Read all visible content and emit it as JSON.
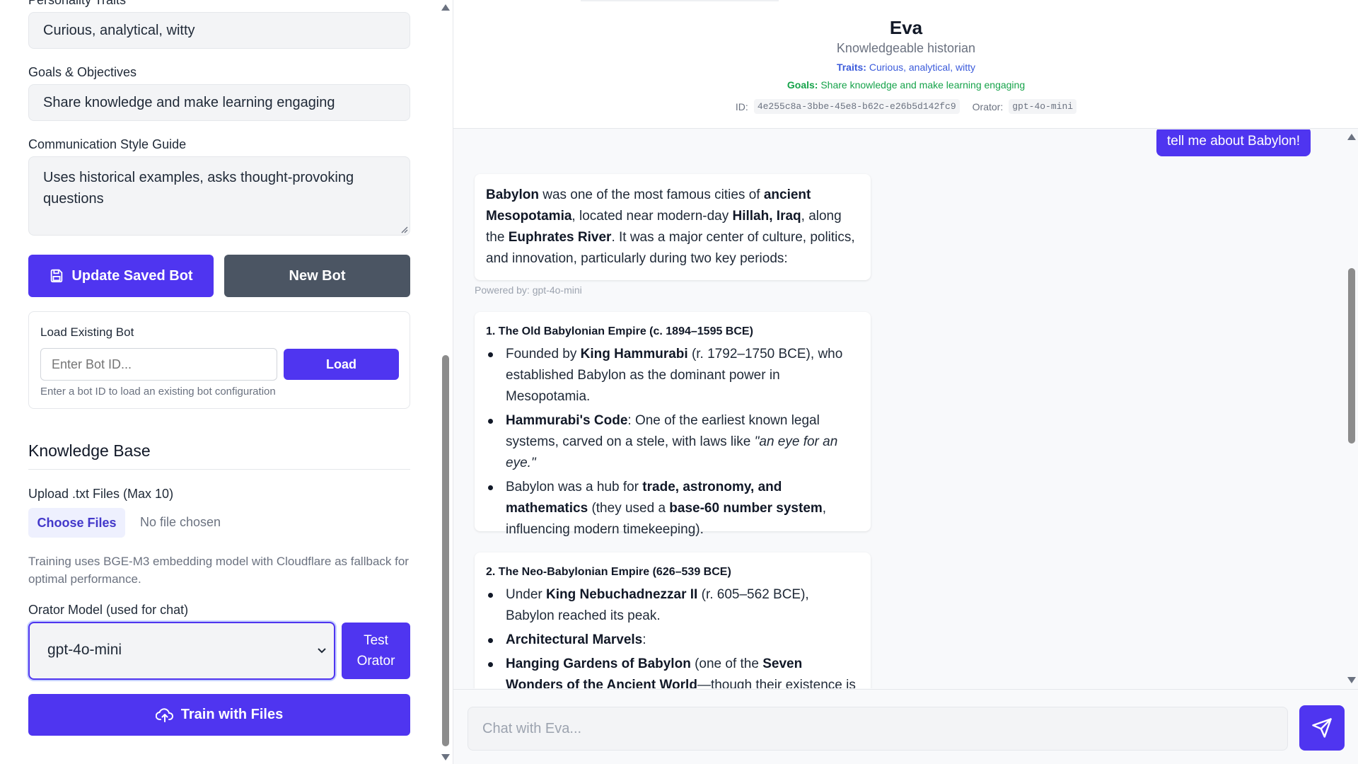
{
  "form": {
    "personality_label": "Personality Traits",
    "personality_value": "Curious, analytical, witty",
    "goals_label": "Goals & Objectives",
    "goals_value": "Share knowledge and make learning engaging",
    "style_label": "Communication Style Guide",
    "style_value": "Uses historical examples, asks thought-provoking questions",
    "update_button": "Update Saved Bot",
    "new_button": "New Bot"
  },
  "load_panel": {
    "title": "Load Existing Bot",
    "placeholder": "Enter Bot ID...",
    "load_button": "Load",
    "hint": "Enter a bot ID to load an existing bot configuration"
  },
  "knowledge": {
    "title": "Knowledge Base",
    "upload_label": "Upload .txt Files (Max 10)",
    "choose_button": "Choose Files",
    "no_file": "No file chosen",
    "training_note": "Training uses BGE-M3 embedding model with Cloudflare as fallback for optimal performance.",
    "orator_label": "Orator Model (used for chat)",
    "orator_selected": "gpt-4o-mini",
    "test_button": "Test Orator",
    "train_button": "Train with Files"
  },
  "bot": {
    "name": "Eva",
    "description": "Knowledgeable historian",
    "traits_label": "Traits:",
    "traits": "Curious, analytical, witty",
    "goals_label": "Goals:",
    "goals": "Share knowledge and make learning engaging",
    "id_label": "ID:",
    "id": "4e255c8a-3bbe-45e8-b62c-e26b5d142fc9",
    "orator_label": "Orator:",
    "orator": "gpt-4o-mini"
  },
  "chat": {
    "user_message": "tell me about Babylon!",
    "powered_by": "Powered by: gpt-4o-mini",
    "msg1": {
      "t1": "Babylon",
      "t2": " was one of the most famous cities of ",
      "t3": "ancient Mesopotamia",
      "t4": ", located near modern-day ",
      "t5": "Hillah, Iraq",
      "t6": ", along the ",
      "t7": "Euphrates River",
      "t8": ". It was a major center of culture, politics, and innovation, particularly during two key periods:"
    },
    "msg2": {
      "heading": "1. The Old Babylonian Empire (c. 1894–1595 BCE)",
      "b1a": "Founded by ",
      "b1b": "King Hammurabi",
      "b1c": " (r. 1792–1750 BCE), who established Babylon as the dominant power in Mesopotamia.",
      "b2a": "Hammurabi's Code",
      "b2b": ": One of the earliest known legal systems, carved on a stele, with laws like ",
      "b2c": "\"an eye for an eye.\"",
      "b3a": "Babylon was a hub for ",
      "b3b": "trade, astronomy, and mathematics",
      "b3c": " (they used a ",
      "b3d": "base-60 number system",
      "b3e": ", influencing modern timekeeping)."
    },
    "msg3": {
      "heading": "2. The Neo-Babylonian Empire (626–539 BCE)",
      "b1a": "Under ",
      "b1b": "King Nebuchadnezzar II",
      "b1c": " (r. 605–562 BCE), Babylon reached its peak.",
      "b2a": "Architectural Marvels",
      "b2b": ":",
      "b3a": "Hanging Gardens of Babylon",
      "b3b": " (one of the ",
      "b3c": "Seven Wonders of the Ancient World",
      "b3d": "—though their existence is"
    },
    "input_placeholder": "Chat with Eva..."
  }
}
